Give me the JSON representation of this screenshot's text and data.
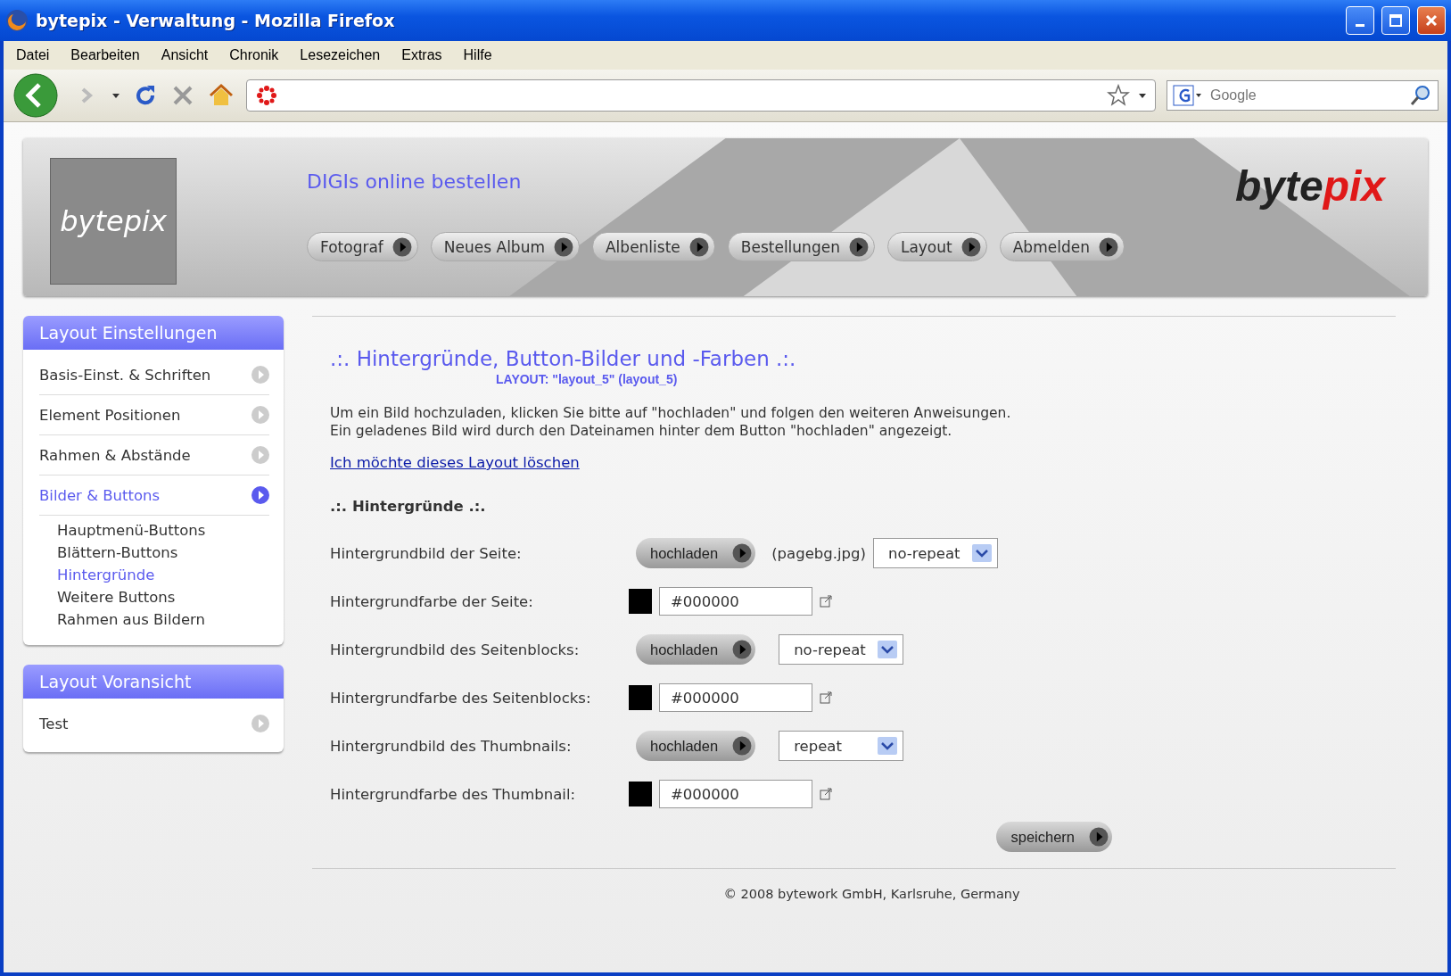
{
  "window": {
    "title": "bytepix - Verwaltung - Mozilla Firefox"
  },
  "menu": [
    {
      "label": "Datei"
    },
    {
      "label": "Bearbeiten"
    },
    {
      "label": "Ansicht"
    },
    {
      "label": "Chronik"
    },
    {
      "label": "Lesezeichen"
    },
    {
      "label": "Extras"
    },
    {
      "label": "Hilfe"
    }
  ],
  "toolbar": {
    "search_placeholder": "Google"
  },
  "header": {
    "logo_text": "bytepix",
    "tagline": "DIGIs online bestellen",
    "brand_left": "byte",
    "brand_right": "pix",
    "nav": [
      {
        "label": "Fotograf"
      },
      {
        "label": "Neues Album"
      },
      {
        "label": "Albenliste"
      },
      {
        "label": "Bestellungen"
      },
      {
        "label": "Layout"
      },
      {
        "label": "Abmelden"
      }
    ]
  },
  "sidebar": [
    {
      "title": "Layout Einstellungen",
      "items": [
        {
          "label": "Basis-Einst. & Schriften",
          "selected": false
        },
        {
          "label": "Element Positionen",
          "selected": false
        },
        {
          "label": "Rahmen & Abstände",
          "selected": false
        },
        {
          "label": "Bilder & Buttons",
          "selected": true,
          "children": [
            {
              "label": "Hauptmenü-Buttons",
              "selected": false
            },
            {
              "label": "Blättern-Buttons",
              "selected": false
            },
            {
              "label": "Hintergründe",
              "selected": true
            },
            {
              "label": "Weitere Buttons",
              "selected": false
            },
            {
              "label": "Rahmen aus Bildern",
              "selected": false
            }
          ]
        }
      ]
    },
    {
      "title": "Layout Voransicht",
      "items": [
        {
          "label": "Test",
          "selected": false
        }
      ]
    }
  ],
  "content": {
    "title": ".:. Hintergründe, Button-Bilder und -Farben .:.",
    "subtitle": "LAYOUT: \"layout_5\" (layout_5)",
    "intro": [
      "Um ein Bild hochzuladen, klicken Sie bitte auf \"hochladen\" und folgen den weiteren Anweisungen.",
      "Ein geladenes Bild wird durch den Dateinamen hinter dem Button \"hochladen\" angezeigt."
    ],
    "delete_link": "Ich möchte dieses Layout löschen",
    "section": ".:. Hintergründe .:.",
    "rows": [
      {
        "kind": "image",
        "label": "Hintergrundbild der Seite:",
        "button": "hochladen",
        "filename": "(pagebg.jpg)",
        "repeat": "no-repeat"
      },
      {
        "kind": "color",
        "label": "Hintergrundfarbe der Seite:",
        "color": "#000000",
        "value": "#000000"
      },
      {
        "kind": "image",
        "label": "Hintergrundbild des Seitenblocks:",
        "button": "hochladen",
        "repeat": "no-repeat"
      },
      {
        "kind": "color",
        "label": "Hintergrundfarbe des Seitenblocks:",
        "color": "#000000",
        "value": "#000000"
      },
      {
        "kind": "image",
        "label": "Hintergrundbild des Thumbnails:",
        "button": "hochladen",
        "repeat": "repeat"
      },
      {
        "kind": "color",
        "label": "Hintergrundfarbe des Thumbnail:",
        "color": "#000000",
        "value": "#000000"
      }
    ],
    "save": "speichern",
    "footer": "© 2008 bytework GmbH, Karlsruhe, Germany"
  }
}
